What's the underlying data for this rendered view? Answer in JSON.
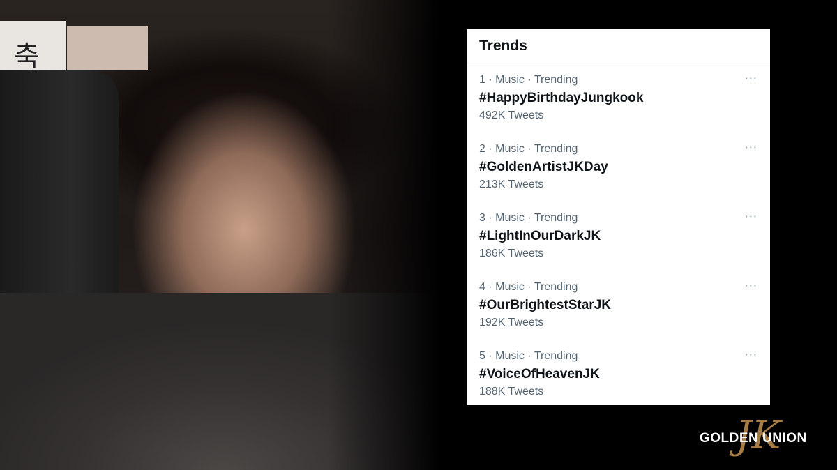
{
  "photo_poster_text": "축",
  "trends": {
    "title": "Trends",
    "items": [
      {
        "rank": "1",
        "meta": "· Music · Trending",
        "name": "#HappyBirthdayJungkook",
        "count": "492K Tweets",
        "more": "···"
      },
      {
        "rank": "2",
        "meta": "· Music · Trending",
        "name": "#GoldenArtistJKDay",
        "count": "213K Tweets",
        "more": "···"
      },
      {
        "rank": "3",
        "meta": "· Music · Trending",
        "name": "#LightInOurDarkJK",
        "count": "186K Tweets",
        "more": "···"
      },
      {
        "rank": "4",
        "meta": "· Music · Trending",
        "name": "#OurBrightestStarJK",
        "count": "192K Tweets",
        "more": "···"
      },
      {
        "rank": "5",
        "meta": "· Music · Trending",
        "name": "#VoiceOfHeavenJK",
        "count": "188K Tweets",
        "more": "···"
      }
    ]
  },
  "logo": {
    "text": "GOLDEN UNION",
    "monogram": "JK"
  },
  "colors": {
    "card_bg": "#ffffff",
    "text_primary": "#0f1419",
    "text_secondary": "#536471",
    "logo_gold": "#b88a4e"
  }
}
